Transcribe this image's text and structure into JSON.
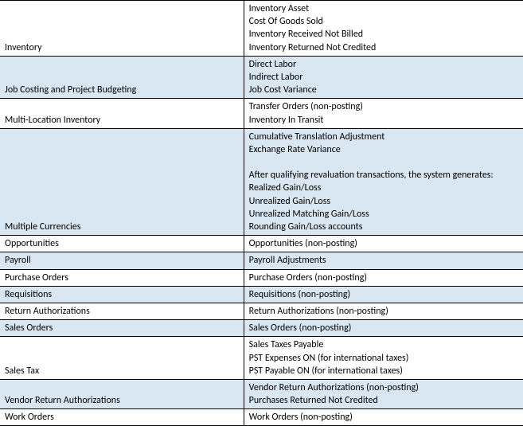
{
  "rows": [
    {
      "band": "white",
      "left": "Inventory",
      "right": "Inventory Asset\nCost Of Goods Sold\nInventory Received Not Billed\nInventory Returned Not Credited"
    },
    {
      "band": "blue",
      "left": "Job Costing and Project Budgeting",
      "right": "Direct Labor\nIndirect Labor\nJob Cost Variance"
    },
    {
      "band": "white",
      "left": "Multi-Location Inventory",
      "right": "Transfer Orders (non-posting)\nInventory In Transit"
    },
    {
      "band": "blue",
      "left": "Multiple Currencies",
      "right": "Cumulative Translation Adjustment\nExchange Rate Variance\n\nAfter qualifying revaluation transactions, the system generates:\nRealized Gain/Loss\nUnrealized Gain/Loss\nUnrealized Matching Gain/Loss\nRounding Gain/Loss accounts"
    },
    {
      "band": "white",
      "left": "Opportunities",
      "right": "Opportunities (non-posting)"
    },
    {
      "band": "blue",
      "left": "Payroll",
      "right": "Payroll Adjustments"
    },
    {
      "band": "white",
      "left": "Purchase Orders",
      "right": "Purchase Orders (non-posting)"
    },
    {
      "band": "blue",
      "left": "Requisitions",
      "right": "Requisitions (non-posting)"
    },
    {
      "band": "white",
      "left": "Return Authorizations",
      "right": "Return Authorizations (non-posting)"
    },
    {
      "band": "blue",
      "left": "Sales Orders",
      "right": "Sales Orders (non-posting)"
    },
    {
      "band": "white",
      "left": "Sales Tax",
      "right": "Sales Taxes Payable\nPST Expenses ON (for international taxes)\nPST Payable ON (for international taxes)"
    },
    {
      "band": "blue",
      "left": "Vendor Return Authorizations",
      "right": "Vendor Return Authorizations (non-posting)\nPurchases Returned Not Credited"
    },
    {
      "band": "white",
      "left": "Work Orders",
      "right": "Work Orders (non-posting)"
    }
  ]
}
